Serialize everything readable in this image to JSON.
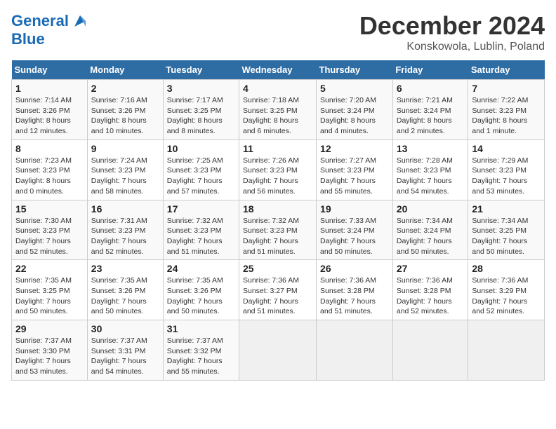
{
  "header": {
    "logo_line1": "General",
    "logo_line2": "Blue",
    "month": "December 2024",
    "location": "Konskowola, Lublin, Poland"
  },
  "days_of_week": [
    "Sunday",
    "Monday",
    "Tuesday",
    "Wednesday",
    "Thursday",
    "Friday",
    "Saturday"
  ],
  "weeks": [
    [
      {
        "day": "1",
        "info": "Sunrise: 7:14 AM\nSunset: 3:26 PM\nDaylight: 8 hours\nand 12 minutes."
      },
      {
        "day": "2",
        "info": "Sunrise: 7:16 AM\nSunset: 3:26 PM\nDaylight: 8 hours\nand 10 minutes."
      },
      {
        "day": "3",
        "info": "Sunrise: 7:17 AM\nSunset: 3:25 PM\nDaylight: 8 hours\nand 8 minutes."
      },
      {
        "day": "4",
        "info": "Sunrise: 7:18 AM\nSunset: 3:25 PM\nDaylight: 8 hours\nand 6 minutes."
      },
      {
        "day": "5",
        "info": "Sunrise: 7:20 AM\nSunset: 3:24 PM\nDaylight: 8 hours\nand 4 minutes."
      },
      {
        "day": "6",
        "info": "Sunrise: 7:21 AM\nSunset: 3:24 PM\nDaylight: 8 hours\nand 2 minutes."
      },
      {
        "day": "7",
        "info": "Sunrise: 7:22 AM\nSunset: 3:23 PM\nDaylight: 8 hours\nand 1 minute."
      }
    ],
    [
      {
        "day": "8",
        "info": "Sunrise: 7:23 AM\nSunset: 3:23 PM\nDaylight: 8 hours\nand 0 minutes."
      },
      {
        "day": "9",
        "info": "Sunrise: 7:24 AM\nSunset: 3:23 PM\nDaylight: 7 hours\nand 58 minutes."
      },
      {
        "day": "10",
        "info": "Sunrise: 7:25 AM\nSunset: 3:23 PM\nDaylight: 7 hours\nand 57 minutes."
      },
      {
        "day": "11",
        "info": "Sunrise: 7:26 AM\nSunset: 3:23 PM\nDaylight: 7 hours\nand 56 minutes."
      },
      {
        "day": "12",
        "info": "Sunrise: 7:27 AM\nSunset: 3:23 PM\nDaylight: 7 hours\nand 55 minutes."
      },
      {
        "day": "13",
        "info": "Sunrise: 7:28 AM\nSunset: 3:23 PM\nDaylight: 7 hours\nand 54 minutes."
      },
      {
        "day": "14",
        "info": "Sunrise: 7:29 AM\nSunset: 3:23 PM\nDaylight: 7 hours\nand 53 minutes."
      }
    ],
    [
      {
        "day": "15",
        "info": "Sunrise: 7:30 AM\nSunset: 3:23 PM\nDaylight: 7 hours\nand 52 minutes."
      },
      {
        "day": "16",
        "info": "Sunrise: 7:31 AM\nSunset: 3:23 PM\nDaylight: 7 hours\nand 52 minutes."
      },
      {
        "day": "17",
        "info": "Sunrise: 7:32 AM\nSunset: 3:23 PM\nDaylight: 7 hours\nand 51 minutes."
      },
      {
        "day": "18",
        "info": "Sunrise: 7:32 AM\nSunset: 3:23 PM\nDaylight: 7 hours\nand 51 minutes."
      },
      {
        "day": "19",
        "info": "Sunrise: 7:33 AM\nSunset: 3:24 PM\nDaylight: 7 hours\nand 50 minutes."
      },
      {
        "day": "20",
        "info": "Sunrise: 7:34 AM\nSunset: 3:24 PM\nDaylight: 7 hours\nand 50 minutes."
      },
      {
        "day": "21",
        "info": "Sunrise: 7:34 AM\nSunset: 3:25 PM\nDaylight: 7 hours\nand 50 minutes."
      }
    ],
    [
      {
        "day": "22",
        "info": "Sunrise: 7:35 AM\nSunset: 3:25 PM\nDaylight: 7 hours\nand 50 minutes."
      },
      {
        "day": "23",
        "info": "Sunrise: 7:35 AM\nSunset: 3:26 PM\nDaylight: 7 hours\nand 50 minutes."
      },
      {
        "day": "24",
        "info": "Sunrise: 7:35 AM\nSunset: 3:26 PM\nDaylight: 7 hours\nand 50 minutes."
      },
      {
        "day": "25",
        "info": "Sunrise: 7:36 AM\nSunset: 3:27 PM\nDaylight: 7 hours\nand 51 minutes."
      },
      {
        "day": "26",
        "info": "Sunrise: 7:36 AM\nSunset: 3:28 PM\nDaylight: 7 hours\nand 51 minutes."
      },
      {
        "day": "27",
        "info": "Sunrise: 7:36 AM\nSunset: 3:28 PM\nDaylight: 7 hours\nand 52 minutes."
      },
      {
        "day": "28",
        "info": "Sunrise: 7:36 AM\nSunset: 3:29 PM\nDaylight: 7 hours\nand 52 minutes."
      }
    ],
    [
      {
        "day": "29",
        "info": "Sunrise: 7:37 AM\nSunset: 3:30 PM\nDaylight: 7 hours\nand 53 minutes."
      },
      {
        "day": "30",
        "info": "Sunrise: 7:37 AM\nSunset: 3:31 PM\nDaylight: 7 hours\nand 54 minutes."
      },
      {
        "day": "31",
        "info": "Sunrise: 7:37 AM\nSunset: 3:32 PM\nDaylight: 7 hours\nand 55 minutes."
      },
      null,
      null,
      null,
      null
    ]
  ]
}
